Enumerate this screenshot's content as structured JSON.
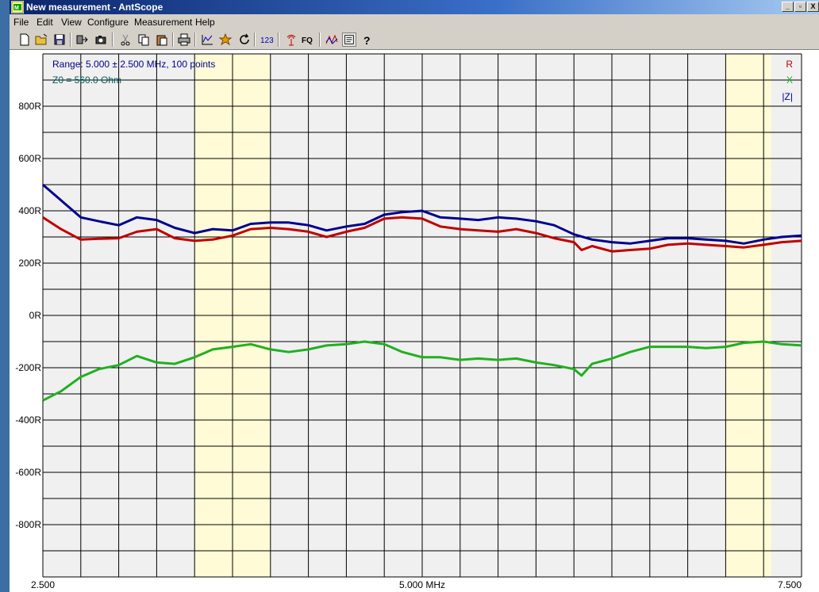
{
  "window": {
    "title": "New measurement - AntScope",
    "controls": {
      "minimize": "_",
      "restore": "▫",
      "close": "X"
    }
  },
  "menu": [
    "File",
    "Edit",
    "View",
    "Configure",
    "Measurement",
    "Help"
  ],
  "toolbar": {
    "buttons": [
      {
        "name": "new-icon"
      },
      {
        "name": "open-folder-icon"
      },
      {
        "name": "save-icon"
      },
      {
        "name": "export-icon"
      },
      {
        "name": "screenshot-icon"
      },
      {
        "name": "cut-icon"
      },
      {
        "name": "copy-icon"
      },
      {
        "name": "paste-icon"
      },
      {
        "name": "print-icon"
      },
      {
        "name": "chart-icon"
      },
      {
        "name": "smith-chart-icon"
      },
      {
        "name": "refresh-icon"
      },
      {
        "name": "single-run-icon",
        "label": "123"
      },
      {
        "name": "antenna-icon"
      },
      {
        "name": "frequency-icon",
        "label": "FQ"
      },
      {
        "name": "multi-plot-icon"
      },
      {
        "name": "notes-icon"
      },
      {
        "name": "help-icon"
      }
    ]
  },
  "plot": {
    "info_range": "Range: 5.000 ± 2.500 MHz, 100 points",
    "info_z0": "Z0 = 560.0 Ohm",
    "legend": [
      "R",
      "X",
      "|Z|"
    ],
    "colors": {
      "R": "#c00000",
      "X": "#20b020",
      "Z": "#000090",
      "band": "#fffbd6",
      "bg": "#f0f0f0"
    }
  },
  "chart_data": {
    "type": "line",
    "x_labels": [
      "2.500",
      "5.000 MHz",
      "7.500"
    ],
    "xlim": [
      2.5,
      7.5
    ],
    "ylim": [
      -1000,
      1000
    ],
    "y_ticks": [
      800,
      600,
      400,
      200,
      0,
      -200,
      -400,
      -600,
      -800
    ],
    "y_tick_labels": [
      "800R",
      "600R",
      "400R",
      "200R",
      "0R",
      "-200R",
      "-400R",
      "-600R",
      "-800R"
    ],
    "bands": [
      [
        3.5,
        4.0
      ],
      [
        7.0,
        7.3
      ]
    ],
    "series": [
      {
        "name": "|Z|",
        "color": "#000090",
        "x": [
          2.5,
          2.62,
          2.75,
          2.87,
          3.0,
          3.12,
          3.25,
          3.37,
          3.5,
          3.62,
          3.75,
          3.87,
          4.0,
          4.12,
          4.25,
          4.37,
          4.5,
          4.62,
          4.75,
          4.87,
          5.0,
          5.12,
          5.25,
          5.37,
          5.5,
          5.62,
          5.75,
          5.87,
          6.0,
          6.12,
          6.25,
          6.37,
          6.5,
          6.62,
          6.75,
          6.87,
          7.0,
          7.12,
          7.25,
          7.37,
          7.5
        ],
        "y": [
          500,
          440,
          375,
          360,
          345,
          375,
          365,
          335,
          315,
          330,
          325,
          350,
          355,
          355,
          345,
          325,
          340,
          350,
          385,
          395,
          400,
          375,
          370,
          365,
          375,
          370,
          360,
          345,
          310,
          290,
          280,
          275,
          285,
          295,
          295,
          290,
          285,
          275,
          290,
          300,
          305
        ]
      },
      {
        "name": "R",
        "color": "#c00000",
        "x": [
          2.5,
          2.62,
          2.75,
          2.87,
          3.0,
          3.12,
          3.25,
          3.37,
          3.5,
          3.62,
          3.75,
          3.87,
          4.0,
          4.12,
          4.25,
          4.37,
          4.5,
          4.62,
          4.75,
          4.87,
          5.0,
          5.12,
          5.25,
          5.37,
          5.5,
          5.62,
          5.75,
          5.87,
          6.0,
          6.05,
          6.12,
          6.25,
          6.37,
          6.5,
          6.62,
          6.75,
          6.87,
          7.0,
          7.12,
          7.25,
          7.37,
          7.5
        ],
        "y": [
          375,
          330,
          290,
          293,
          295,
          320,
          330,
          295,
          285,
          290,
          305,
          330,
          335,
          330,
          320,
          300,
          320,
          335,
          370,
          375,
          370,
          340,
          330,
          325,
          320,
          330,
          315,
          295,
          280,
          250,
          265,
          245,
          250,
          255,
          270,
          275,
          270,
          265,
          260,
          270,
          280,
          285
        ]
      },
      {
        "name": "X",
        "color": "#20b020",
        "x": [
          2.5,
          2.62,
          2.75,
          2.87,
          3.0,
          3.12,
          3.25,
          3.37,
          3.5,
          3.62,
          3.75,
          3.87,
          4.0,
          4.12,
          4.25,
          4.37,
          4.5,
          4.62,
          4.75,
          4.87,
          5.0,
          5.12,
          5.25,
          5.37,
          5.5,
          5.62,
          5.75,
          5.87,
          6.0,
          6.05,
          6.12,
          6.25,
          6.37,
          6.5,
          6.62,
          6.75,
          6.87,
          7.0,
          7.12,
          7.25,
          7.37,
          7.5
        ],
        "y": [
          -325,
          -290,
          -235,
          -205,
          -190,
          -155,
          -180,
          -185,
          -160,
          -130,
          -120,
          -110,
          -130,
          -140,
          -130,
          -115,
          -110,
          -100,
          -110,
          -140,
          -160,
          -160,
          -170,
          -165,
          -170,
          -165,
          -180,
          -190,
          -205,
          -230,
          -185,
          -165,
          -140,
          -120,
          -120,
          -120,
          -125,
          -120,
          -105,
          -100,
          -110,
          -115
        ]
      }
    ]
  }
}
